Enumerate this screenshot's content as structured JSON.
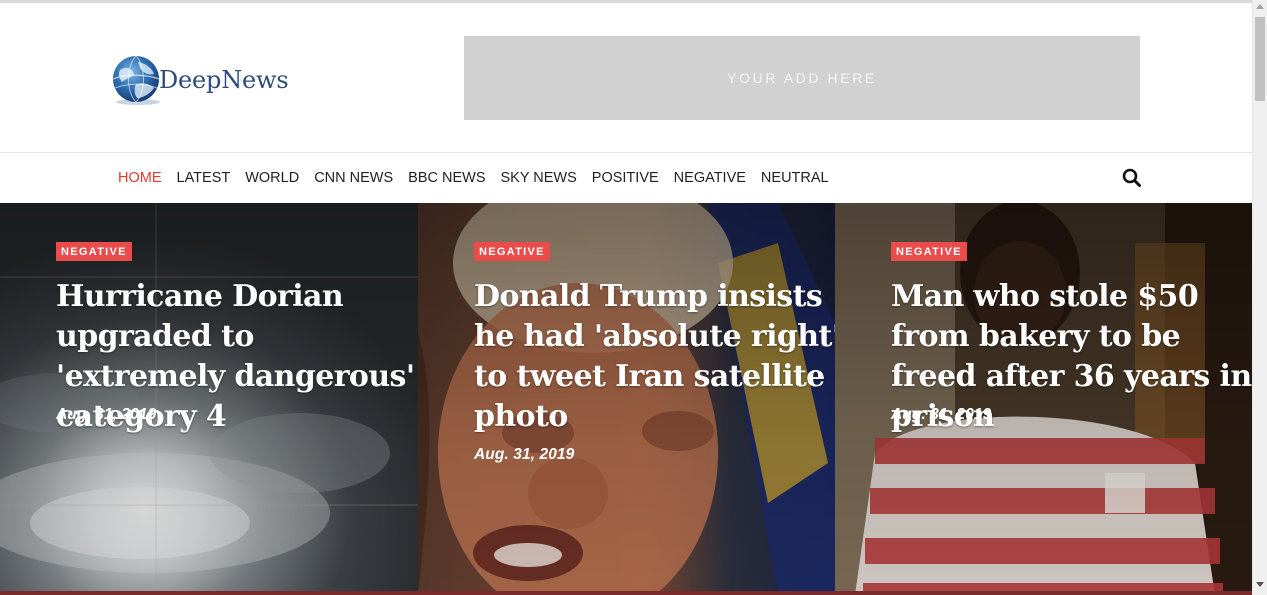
{
  "brand": {
    "name": "DeepNews",
    "logo_icon": "globe-icon"
  },
  "ad": {
    "text": "YOUR ADD HERE"
  },
  "nav": {
    "items": [
      {
        "label": "HOME",
        "active": true
      },
      {
        "label": "LATEST"
      },
      {
        "label": "WORLD"
      },
      {
        "label": "CNN NEWS"
      },
      {
        "label": "BBC NEWS"
      },
      {
        "label": "SKY NEWS"
      },
      {
        "label": "POSITIVE"
      },
      {
        "label": "NEGATIVE"
      },
      {
        "label": "NEUTRAL"
      }
    ],
    "search_icon": "search-icon",
    "active_color": "#e53b2f"
  },
  "cards": [
    {
      "badge": "NEGATIVE",
      "title": "Hurricane Dorian upgraded to 'extremely dangerous' category 4",
      "date": "Aug. 31, 2019"
    },
    {
      "badge": "NEGATIVE",
      "title": "Donald Trump insists he had 'absolute right' to tweet Iran satellite photo",
      "date": "Aug. 31, 2019"
    },
    {
      "badge": "NEGATIVE",
      "title": "Man who stole $50 from bakery to be freed after 36 years in prison",
      "date": "Aug. 31, 2019"
    }
  ],
  "colors": {
    "badge": "#ea4c4c",
    "brand_text": "#2f4a7d",
    "ad_bg": "#d1d1d1"
  }
}
